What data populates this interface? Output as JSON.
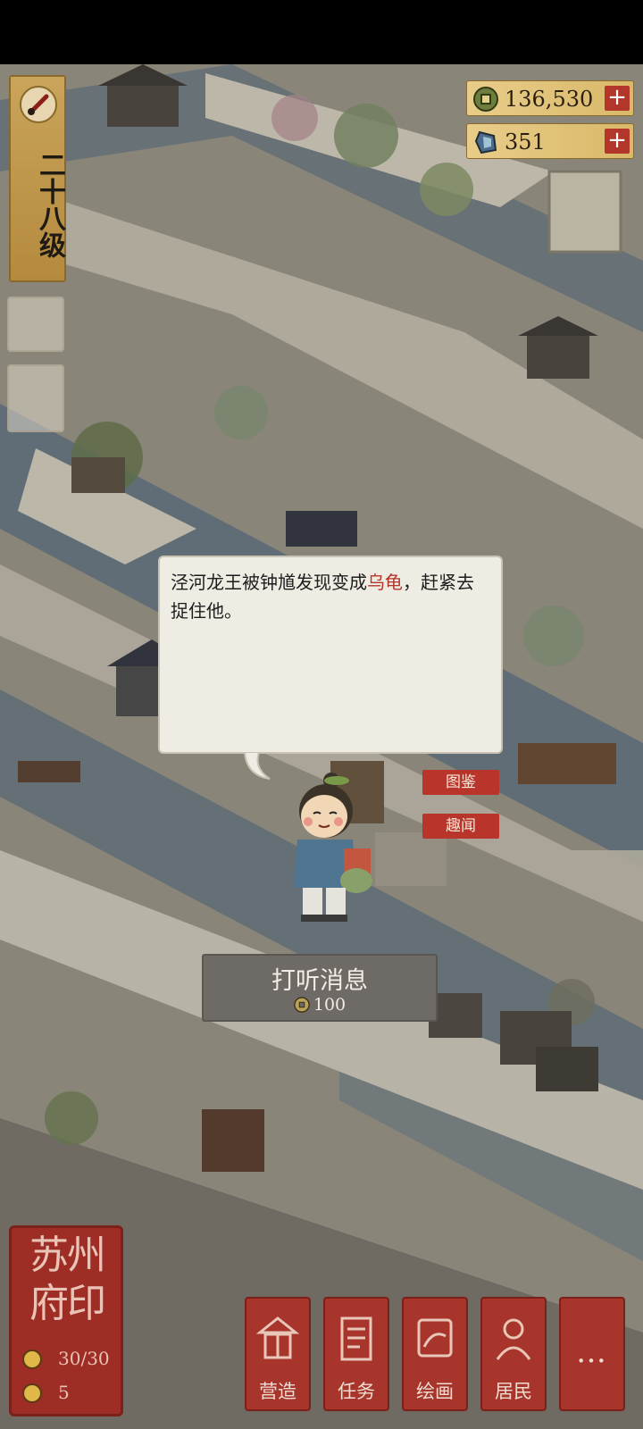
{
  "player": {
    "level_label": "二十八级"
  },
  "currency": [
    {
      "name": "coins",
      "value": "136,530",
      "icon": "copper-coin-icon"
    },
    {
      "name": "jade",
      "value": "351",
      "icon": "jade-gem-icon"
    }
  ],
  "dialog": {
    "text_before": "泾河龙王被钟馗发现变成",
    "highlight": "乌龟",
    "text_after": "，赶紧去捉住他。",
    "highlight_color": "#b3362b"
  },
  "side_tabs": {
    "catalog": "图鉴",
    "anecdote": "趣闻"
  },
  "inquire": {
    "title": "打听消息",
    "cost": "100"
  },
  "seal": {
    "title": "苏州府印",
    "stamina": "30/30",
    "count": "5"
  },
  "bottom_nav": [
    {
      "label": "营造",
      "icon": "construction-icon"
    },
    {
      "label": "任务",
      "icon": "task-scroll-icon"
    },
    {
      "label": "绘画",
      "icon": "painting-scroll-icon"
    },
    {
      "label": "居民",
      "icon": "resident-icon"
    },
    {
      "label": "…",
      "icon": "more-icon"
    }
  ],
  "colors": {
    "accent_red": "#b3362b",
    "gold": "#c9a45a"
  }
}
